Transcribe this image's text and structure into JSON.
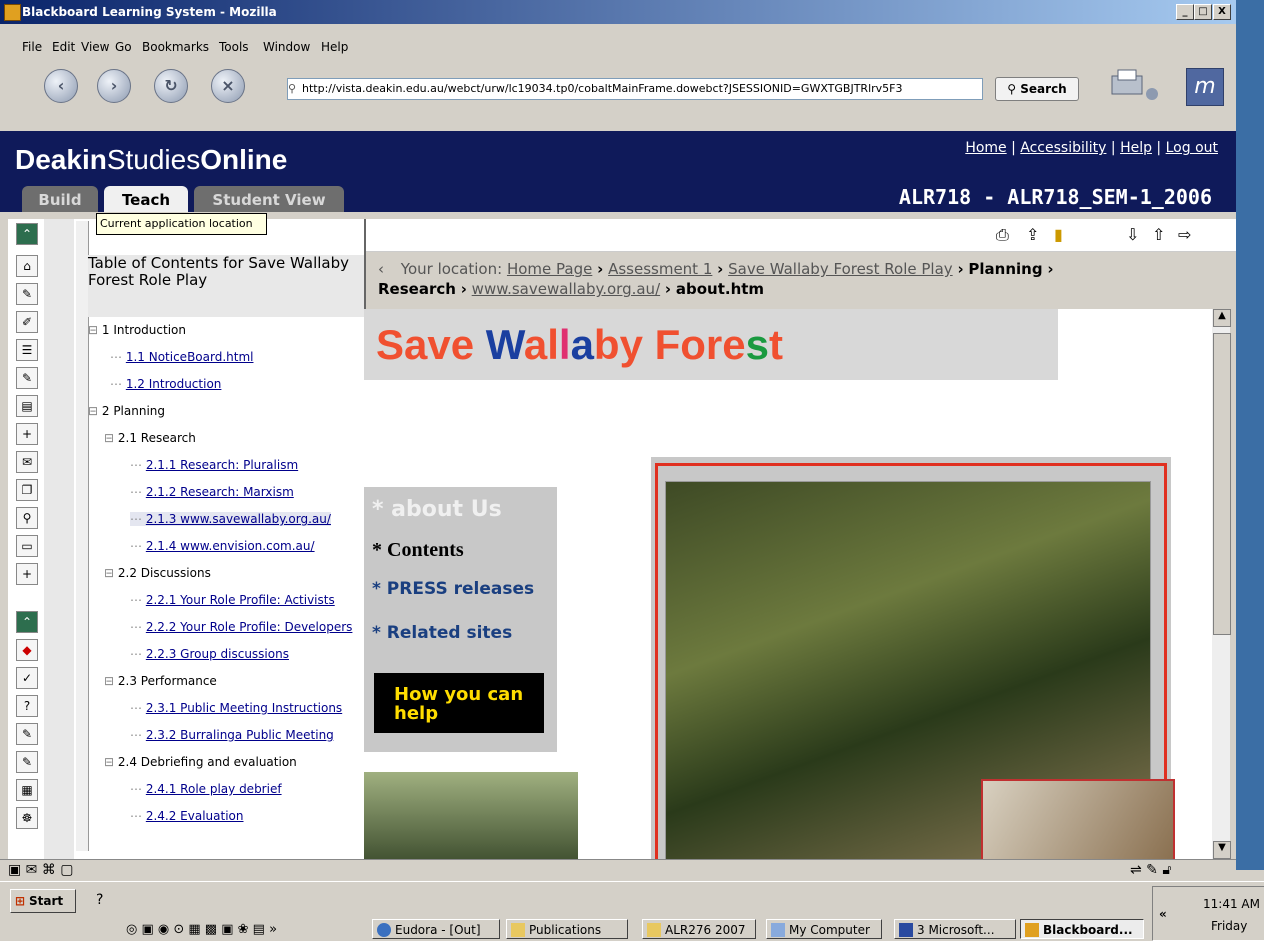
{
  "window": {
    "title": "Blackboard Learning System - Mozilla",
    "min": "_",
    "max": "□",
    "close": "X"
  },
  "menu": [
    "File",
    "Edit",
    "View",
    "Go",
    "Bookmarks",
    "Tools",
    "Window",
    "Help"
  ],
  "nav": {
    "back": "‹",
    "forward": "›",
    "reload": "↻",
    "stop": "×",
    "url": "http://vista.deakin.edu.au/webct/urw/lc19034.tp0/cobaltMainFrame.dowebct?JSESSIONID=GWXTGBJTRlrv5F3",
    "search": "Search"
  },
  "banner": {
    "logo_bold1": "Deakin",
    "logo_mid": "Studies",
    "logo_bold2": "Online",
    "links": [
      "Home",
      "Accessibility",
      "Help",
      "Log out"
    ],
    "course": "ALR718 - ALR718_SEM-1_2006"
  },
  "tabs": [
    "Build",
    "Teach",
    "Student View"
  ],
  "tooltip": "Current application location",
  "toc": {
    "heading": "Table of Contents for Save Wallaby Forest Role Play",
    "items": [
      {
        "label": "1 Introduction",
        "link": false
      },
      {
        "label": "1.1 NoticeBoard.html",
        "link": true
      },
      {
        "label": "1.2 Introduction",
        "link": true
      },
      {
        "label": "2 Planning",
        "link": false
      },
      {
        "label": "2.1 Research",
        "link": false
      },
      {
        "label": "2.1.1 Research: Pluralism",
        "link": true
      },
      {
        "label": "2.1.2 Research: Marxism",
        "link": true
      },
      {
        "label": "2.1.3 www.savewallaby.org.au/",
        "link": true
      },
      {
        "label": "2.1.4 www.envision.com.au/",
        "link": true
      },
      {
        "label": "2.2 Discussions",
        "link": false
      },
      {
        "label": "2.2.1 Your Role Profile: Activists",
        "link": true
      },
      {
        "label": "2.2.2 Your Role Profile: Developers",
        "link": true
      },
      {
        "label": "2.2.3 Group discussions",
        "link": true
      },
      {
        "label": "2.3 Performance",
        "link": false
      },
      {
        "label": "2.3.1 Public Meeting Instructions",
        "link": true
      },
      {
        "label": "2.3.2 Burralinga Public Meeting",
        "link": true
      },
      {
        "label": "2.4 Debriefing and evaluation",
        "link": false
      },
      {
        "label": "2.4.1 Role play debrief",
        "link": true
      },
      {
        "label": "2.4.2 Evaluation",
        "link": true
      }
    ]
  },
  "breadcrumb": {
    "prefix": "Your location:",
    "links": [
      "Home Page",
      "Assessment 1",
      "Save Wallaby Forest Role Play"
    ],
    "bold1": "Planning",
    "bold2": "Research",
    "link4": "www.savewallaby.org.au/",
    "current": "about.htm",
    "sep": "›"
  },
  "page": {
    "title_parts": [
      {
        "t": "Save ",
        "c": "#f05030"
      },
      {
        "t": "W",
        "c": "#1a3fa0"
      },
      {
        "t": "al",
        "c": "#f05030"
      },
      {
        "t": "l",
        "c": "#e03070"
      },
      {
        "t": "a",
        "c": "#1a3fa0"
      },
      {
        "t": "by Fore",
        "c": "#f05030"
      },
      {
        "t": "s",
        "c": "#1a9a40"
      },
      {
        "t": "t",
        "c": "#f05030"
      }
    ],
    "menu": [
      "* about Us",
      "* Contents",
      "* PRESS releases",
      "* Related sites"
    ],
    "help": "How you can help"
  },
  "taskbar": {
    "start": "Start",
    "tasks": [
      "Eudora - [Out]",
      "Publications",
      "ALR276 2007",
      "My Computer",
      "3 Microsoft...",
      "Blackboard..."
    ],
    "time": "11:41 AM",
    "day": "Friday"
  }
}
